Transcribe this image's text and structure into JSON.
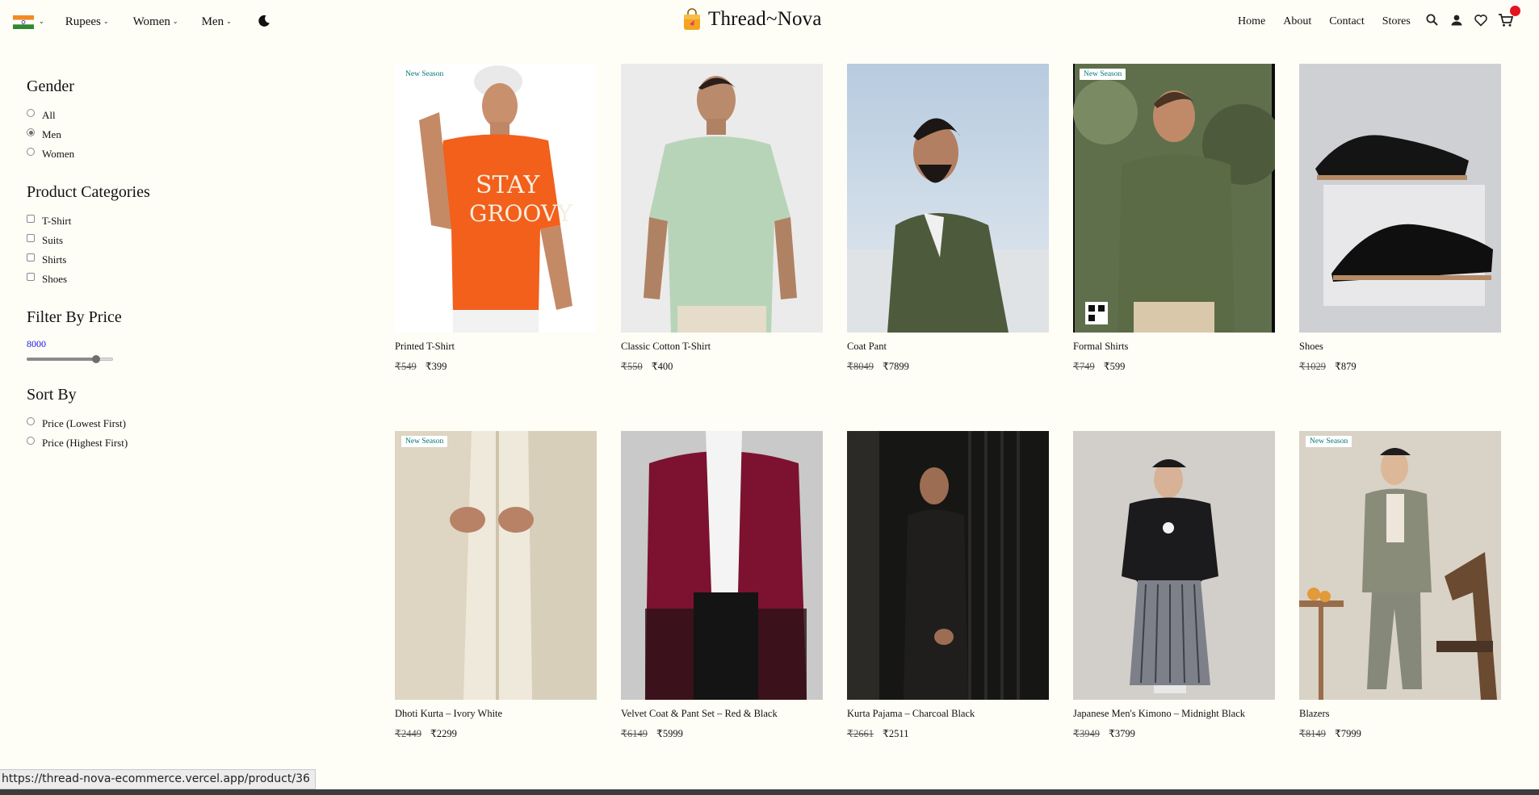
{
  "header": {
    "currency_label": "Rupees",
    "women_label": "Women",
    "men_label": "Men",
    "brand_name": "Thread~Nova",
    "nav": [
      "Home",
      "About",
      "Contact",
      "Stores"
    ],
    "icons": [
      "search-icon",
      "user-icon",
      "heart-icon",
      "cart-icon"
    ],
    "flag": "india-flag-icon"
  },
  "sidebar": {
    "gender": {
      "heading": "Gender",
      "options": [
        "All",
        "Men",
        "Women"
      ],
      "selected": "Men"
    },
    "categories": {
      "heading": "Product Categories",
      "options": [
        "T-Shirt",
        "Suits",
        "Shirts",
        "Shoes"
      ]
    },
    "price": {
      "heading": "Filter By Price",
      "value": "8000",
      "slider_fraction": 0.8
    },
    "sort": {
      "heading": "Sort By",
      "options": [
        "Price (Lowest First)",
        "Price (Highest First)"
      ]
    }
  },
  "products": [
    {
      "title": "Printed T-Shirt",
      "old_price": "₹549",
      "price": "₹399",
      "badge": "New Season"
    },
    {
      "title": "Classic Cotton T-Shirt",
      "old_price": "₹550",
      "price": "₹400",
      "badge": ""
    },
    {
      "title": "Coat Pant",
      "old_price": "₹8049",
      "price": "₹7899",
      "badge": ""
    },
    {
      "title": "Formal Shirts",
      "old_price": "₹749",
      "price": "₹599",
      "badge": "New Season"
    },
    {
      "title": "Shoes",
      "old_price": "₹1029",
      "price": "₹879",
      "badge": ""
    },
    {
      "title": "Dhoti Kurta – Ivory White",
      "old_price": "₹2449",
      "price": "₹2299",
      "badge": "New Season"
    },
    {
      "title": "Velvet Coat & Pant Set – Red & Black",
      "old_price": "₹6149",
      "price": "₹5999",
      "badge": ""
    },
    {
      "title": "Kurta Pajama – Charcoal Black",
      "old_price": "₹2661",
      "price": "₹2511",
      "badge": ""
    },
    {
      "title": "Japanese Men's Kimono – Midnight Black",
      "old_price": "₹3949",
      "price": "₹3799",
      "badge": ""
    },
    {
      "title": "Blazers",
      "old_price": "₹8149",
      "price": "₹7999",
      "badge": "New Season"
    }
  ],
  "status_url": "https://thread-nova-ecommerce.vercel.app/product/36",
  "colors": {
    "background": "#fefdf6",
    "badge_text": "#007575",
    "price_value": "#1a14e6",
    "cart_dot": "#e3141d"
  }
}
